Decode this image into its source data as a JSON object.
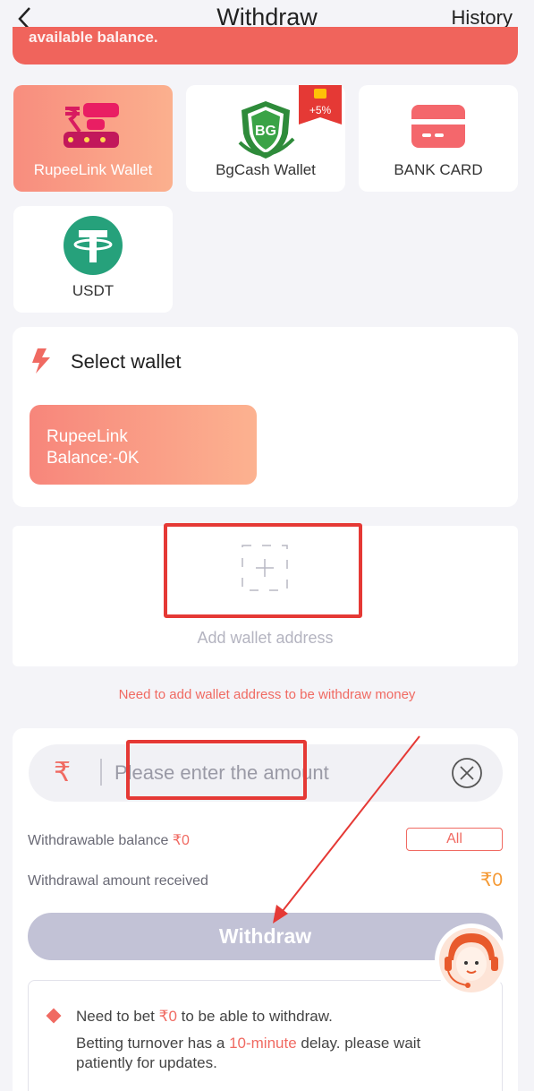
{
  "header": {
    "title": "Withdraw",
    "history_label": "History"
  },
  "notice": {
    "text": "available balance."
  },
  "methods": [
    {
      "label": "RupeeLink Wallet",
      "icon": "rupeelink-logo-icon",
      "active": true
    },
    {
      "label": "BgCash Wallet",
      "icon": "bgcash-logo-icon",
      "badge": "+5%"
    },
    {
      "label": "BANK CARD",
      "icon": "bank-card-icon"
    },
    {
      "label": "USDT",
      "icon": "tether-icon"
    }
  ],
  "select_wallet": {
    "title": "Select wallet",
    "wallet_name": "RupeeLink",
    "wallet_balance": "Balance:-0K"
  },
  "add_wallet": {
    "label": "Add wallet address",
    "note": "Need to add wallet address to be withdraw money"
  },
  "amount": {
    "currency_symbol": "₹",
    "placeholder": "Please enter the amount",
    "withdrawable_label": "Withdrawable balance",
    "withdrawable_value": "₹0",
    "all_label": "All",
    "received_label": "Withdrawal amount received",
    "received_value": "₹0",
    "withdraw_label": "Withdraw"
  },
  "bet_info": {
    "line1_prefix": "Need to bet",
    "line1_value": "₹0",
    "line1_suffix": "to be able to withdraw.",
    "line2_prefix": "Betting turnover has a",
    "line2_value": "10-minute",
    "line2_suffix": "delay. please wait patiently for updates."
  },
  "colors": {
    "accent": "#f06a62",
    "gradient_start": "#f7867b",
    "gradient_end": "#fcb290",
    "disabled_button": "#c2c2d6",
    "received_value": "#f59a35"
  }
}
